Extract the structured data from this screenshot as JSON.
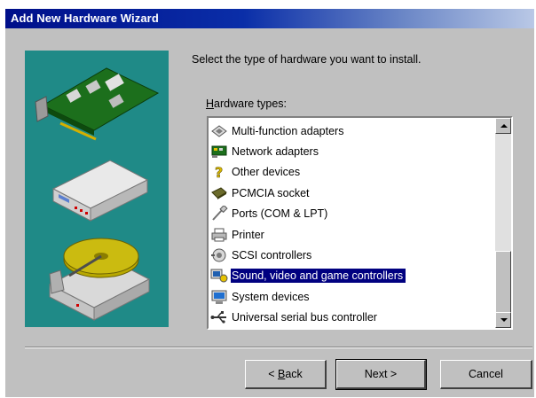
{
  "window": {
    "title": "Add New Hardware Wizard"
  },
  "content": {
    "instruction": "Select the type of hardware you want to install.",
    "list_label_prefix": "H",
    "list_label_rest": "ardware types:"
  },
  "hardware_types": [
    {
      "label": "Multi-function adapters",
      "icon": "multifunction-adapter-icon"
    },
    {
      "label": "Network adapters",
      "icon": "network-adapter-icon"
    },
    {
      "label": "Other devices",
      "icon": "question-mark-icon"
    },
    {
      "label": "PCMCIA socket",
      "icon": "pcmcia-socket-icon"
    },
    {
      "label": "Ports (COM & LPT)",
      "icon": "port-connector-icon"
    },
    {
      "label": "Printer",
      "icon": "printer-icon"
    },
    {
      "label": "SCSI controllers",
      "icon": "scsi-controller-icon"
    },
    {
      "label": "Sound, video and game controllers",
      "icon": "sound-video-game-icon",
      "selected": true
    },
    {
      "label": "System devices",
      "icon": "system-devices-icon"
    },
    {
      "label": "Universal serial bus controller",
      "icon": "usb-controller-icon"
    }
  ],
  "buttons": {
    "back_prefix": "< ",
    "back_hotkey": "B",
    "back_rest": "ack",
    "next": "Next >",
    "cancel": "Cancel"
  },
  "colors": {
    "titlebar": "#000f8a",
    "selection": "#000080",
    "art_panel": "#1f8a87",
    "dialog_face": "#c0c0c0"
  }
}
